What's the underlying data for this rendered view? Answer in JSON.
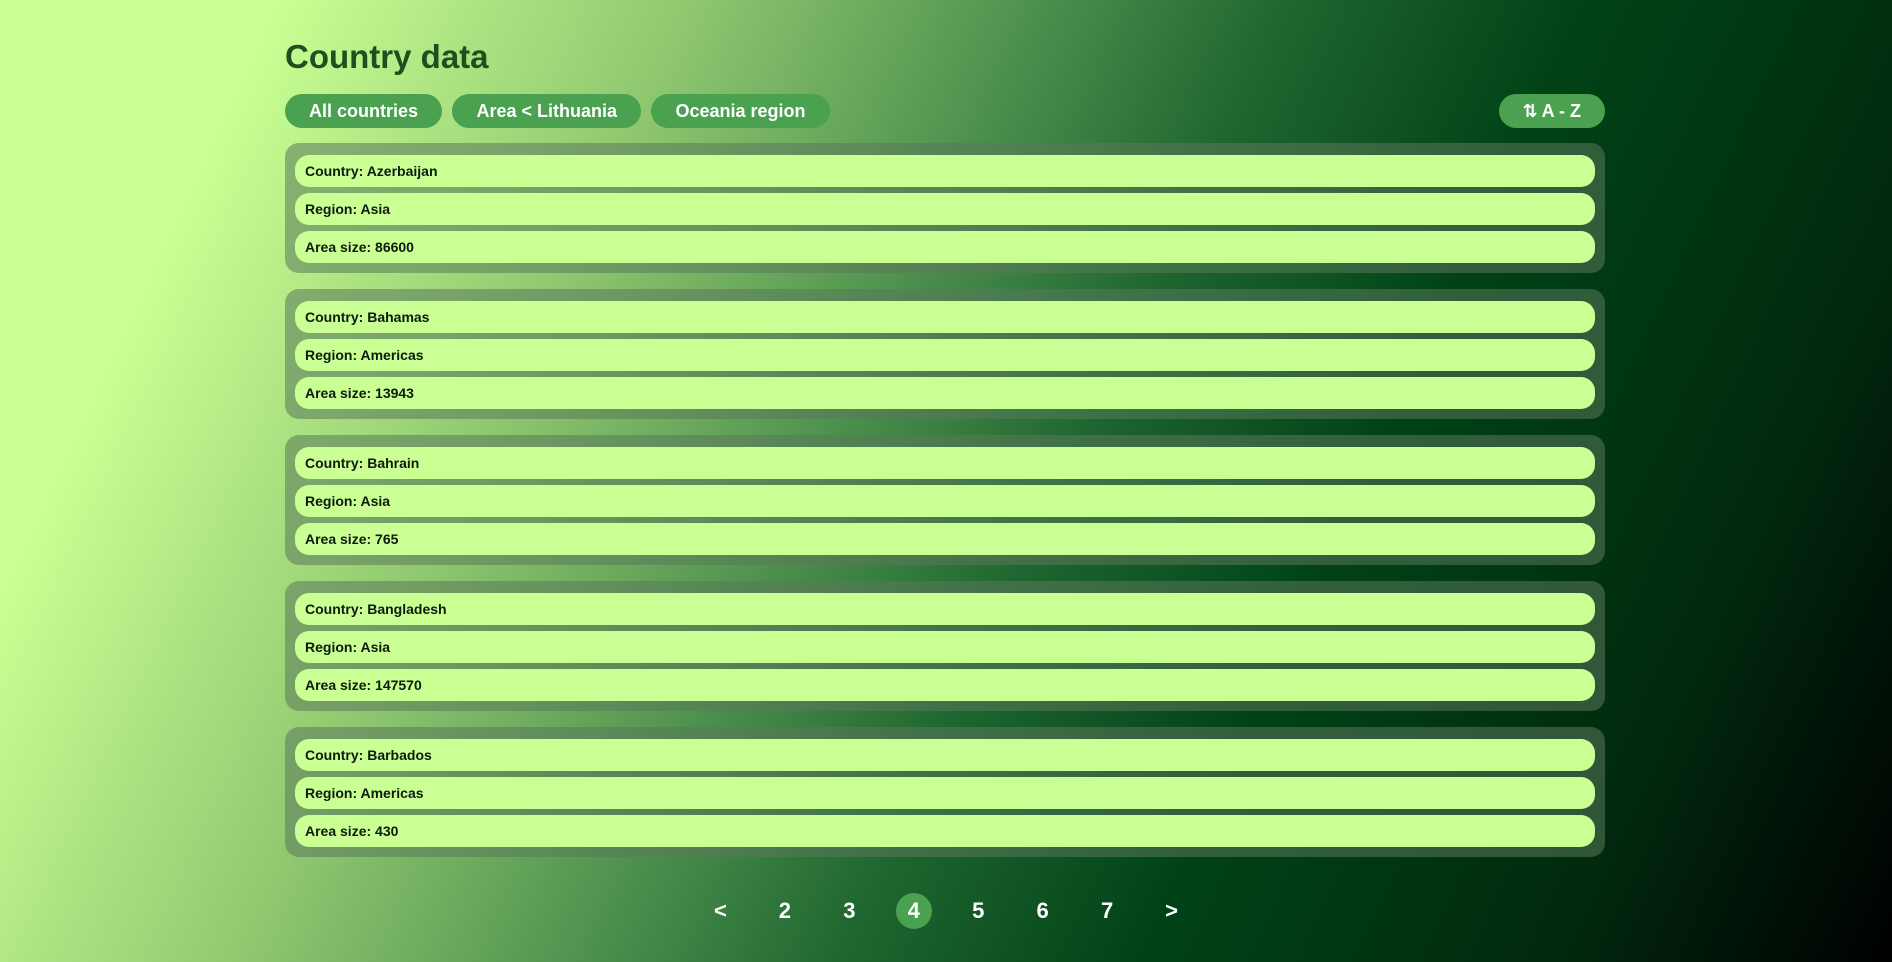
{
  "header": {
    "title": "Country data"
  },
  "filters": {
    "all_label": "All countries",
    "area_label": "Area < Lithuania",
    "oceania_label": "Oceania region"
  },
  "sort": {
    "icon": "⇅",
    "label": "A - Z"
  },
  "countries": [
    {
      "country": "Country: Azerbaijan",
      "region": "Region: Asia",
      "area": "Area size: 86600"
    },
    {
      "country": "Country: Bahamas",
      "region": "Region: Americas",
      "area": "Area size: 13943"
    },
    {
      "country": "Country: Bahrain",
      "region": "Region: Asia",
      "area": "Area size: 765"
    },
    {
      "country": "Country: Bangladesh",
      "region": "Region: Asia",
      "area": "Area size: 147570"
    },
    {
      "country": "Country: Barbados",
      "region": "Region: Americas",
      "area": "Area size: 430"
    }
  ],
  "pagination": {
    "prev": "<",
    "pages": [
      "2",
      "3",
      "4",
      "5",
      "6",
      "7"
    ],
    "next": ">",
    "current": "4"
  },
  "colors": {
    "accent": "#4aa150",
    "row_bg": "#c9ff93",
    "title": "#1d4f1f"
  }
}
